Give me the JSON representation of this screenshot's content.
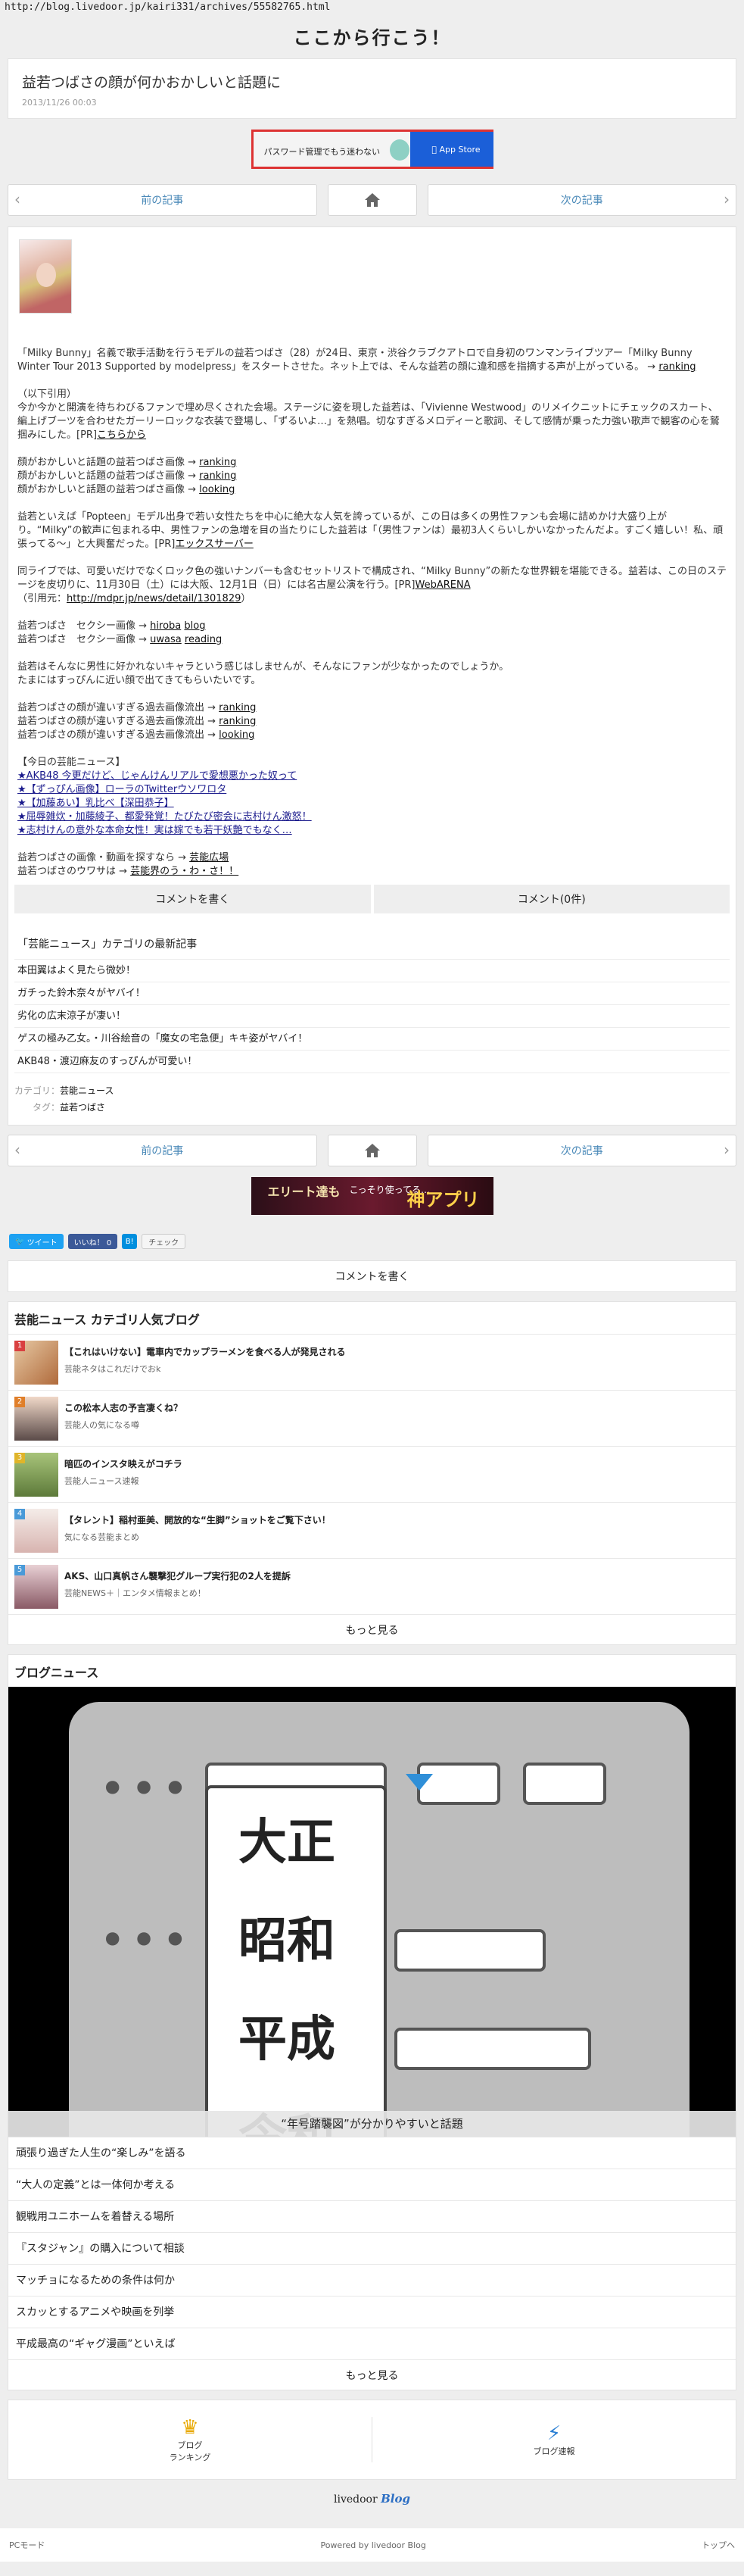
{
  "url": "http://blog.livedoor.jp/kairi331/archives/55582765.html",
  "site_title": "ここから行こう！",
  "article": {
    "title": "益若つばさの顔が何かおかしいと話題に",
    "date": "2013/11/26 00:03"
  },
  "banner1": {
    "text": "パスワード管理でもう迷わない",
    "store": "App Store"
  },
  "pager": {
    "prev": "前の記事",
    "next": "次の記事"
  },
  "body": {
    "p1": "「Milky Bunny」名義で歌手活動を行うモデルの益若つばさ（28）が24日、東京・渋谷クラブクアトロで自身初のワンマンライブツアー「Milky Bunny Winter Tour 2013 Supported by modelpress」をスタートさせた。ネット上では、そんな益若の顔に違和感を指摘する声が上がっている。",
    "p1_link": "ranking",
    "p2_a": "（以下引用）",
    "p2_b": "今か今かと開演を待ちわびるファンで埋め尽くされた会場。ステージに姿を現した益若は、「Vivienne Westwood」のリメイクニットにチェックのスカート、編上げブーツを合わせたガーリーロックな衣装で登場し、「ずるいよ…」を熱唱。切なすぎるメロディーと歌詞、そして感情が乗った力強い歌声で観客の心を鷲掴みにした。[PR]",
    "p2_link": "こちらから",
    "l1_text": "顔がおかしいと話題の益若つばさ画像 →",
    "l1_link": "ranking",
    "l2_text": "顔がおかしいと話題の益若つばさ画像 →",
    "l2_link": "ranking",
    "l3_text": "顔がおかしいと話題の益若つばさ画像 →",
    "l3_link": "looking",
    "p3": "益若といえば「Popteen」モデル出身で若い女性たちを中心に絶大な人気を誇っているが、この日は多くの男性ファンも会場に詰めかけ大盛り上がり。“Milky”の歓声に包まれる中、男性ファンの急増を目の当たりにした益若は「（男性ファンは）最初3人くらいしかいなかったんだよ。すごく嬉しい！私、頑張ってる〜」と大興奮だった。[PR]",
    "p3_link": "エックスサーバー",
    "p4": "同ライブでは、可愛いだけでなくロック色の強いナンバーも含むセットリストで構成され、“Milky Bunny”の新たな世界観を堪能できる。益若は、この日のステージを皮切りに、11月30日（土）には大阪、12月1日（日）には名古屋公演を行う。[PR]",
    "p4_link": "WebARENA",
    "p4_cite": "（引用元：",
    "p4_cite_link": "http://mdpr.jp/news/detail/1301829",
    "p4_cite_end": "）",
    "s1_text": "益若つばさ　セクシー画像 →",
    "s1_l1": "hiroba",
    "s1_l2": "blog",
    "s2_text": "益若つばさ　セクシー画像 →",
    "s2_l1": "uwasa",
    "s2_l2": "reading",
    "p5_a": "益若はそんなに男性に好かれないキャラという感じはしませんが、そんなにファンが少なかったのでしょうか。",
    "p5_b": "たまにはすっぴんに近い顔で出てきてもらいたいです。",
    "o1_text": "益若つばさの顔が違いすぎる過去画像流出 →",
    "o1_link": "ranking",
    "o2_text": "益若つばさの顔が違いすぎる過去画像流出 →",
    "o2_link": "ranking",
    "o3_text": "益若つばさの顔が違いすぎる過去画像流出 →",
    "o3_link": "looking",
    "today_head": "【今日の芸能ニュース】",
    "today": [
      "★AKB48 今更だけど、じゃんけんリアルで愛想悪かった奴って",
      "★【ずっぴん画像】ローラのTwitterウソワロタ",
      "★【加藤あい】乳比べ【深田恭子】",
      "★屈辱雑炊・加藤綾子、都愛発覚！たびたび密会に志村けん激怒！",
      "★志村けんの意外な本命女性！実は嫁でも若干妖艶でもなく…"
    ],
    "f1_text": "益若つばさの画像・動画を探すなら →",
    "f1_link": "芸能広場",
    "f2_text": "益若つばさのウワサは →",
    "f2_link": "芸能界のう・わ・さ！！"
  },
  "comments": {
    "write": "コメントを書く",
    "count": "コメント(0件)"
  },
  "category": {
    "head": "「芸能ニュース」カテゴリの最新記事",
    "items": [
      "本田翼はよく見たら微妙！",
      "ガチった鈴木奈々がヤバイ！",
      "劣化の広末涼子が凄い！",
      "ゲスの極み乙女。・川谷絵音の「魔女の宅急便」キキ姿がヤバイ！",
      "AKB48・渡辺麻友のすっぴんが可愛い！"
    ]
  },
  "meta": {
    "cat_label": "カテゴリ：",
    "cat_value": "芸能ニュース",
    "tag_label": "タグ：",
    "tag_value": "益若つばさ"
  },
  "banner2": {
    "a": "エリート達も",
    "b": "こっそり使ってる…",
    "c": "神アプリ"
  },
  "share": {
    "tweet": "ツイート",
    "like": "いいね！ 0",
    "hatena": "B!",
    "check": "チェック"
  },
  "comment_bar": "コメントを書く",
  "popular": {
    "title": "芸能ニュース カテゴリ人気ブログ",
    "items": [
      {
        "rank": "1",
        "title": "【これはいけない】電車内でカップラーメンを食べる人が発見される",
        "sub": "芸能ネタはこれだけでおk",
        "color": "#d94040"
      },
      {
        "rank": "2",
        "title": "この松本人志の予言凄くね？",
        "sub": "芸能人の気になる噂",
        "color": "#e07f2a"
      },
      {
        "rank": "3",
        "title": "暗匹のインスタ映えがコチラ",
        "sub": "芸能人ニュース速報",
        "color": "#e0b52a"
      },
      {
        "rank": "4",
        "title": "【タレント】稲村亜美、開放的な“生脚”ショットをご覧下さい！",
        "sub": "気になる芸能まとめ",
        "color": "#4a9ad8"
      },
      {
        "rank": "5",
        "title": "AKS、山口真帆さん襲撃犯グループ実行犯の2人を提訴",
        "sub": "芸能NEWS＋｜エンタメ情報まとめ！",
        "color": "#4a9ad8"
      }
    ],
    "more": "もっと見る"
  },
  "blog_news": {
    "title": "ブログニュース",
    "eras": [
      "大正",
      "昭和",
      "平成",
      "令和"
    ],
    "caption": "“年号踏襲図”が分かりやすいと話題",
    "items": [
      "頑張り過ぎた人生の“楽しみ”を語る",
      "“大人の定義”とは一体何か考える",
      "観戦用ユニホームを着替える場所",
      "『スタジャン』の購入について相談",
      "マッチョになるための条件は何か",
      "スカッとするアニメや映画を列挙",
      "平成最高の“ギャグ漫画”といえば"
    ],
    "more": "もっと見る"
  },
  "footer_nav": {
    "ranking": "ブログ\nランキング",
    "breaking": "ブログ速報"
  },
  "logo": {
    "a": "livedoor",
    "b": "Blog"
  },
  "bottom": {
    "pc": "PCモード",
    "powered": "Powered by livedoor Blog",
    "top": "トップへ"
  }
}
